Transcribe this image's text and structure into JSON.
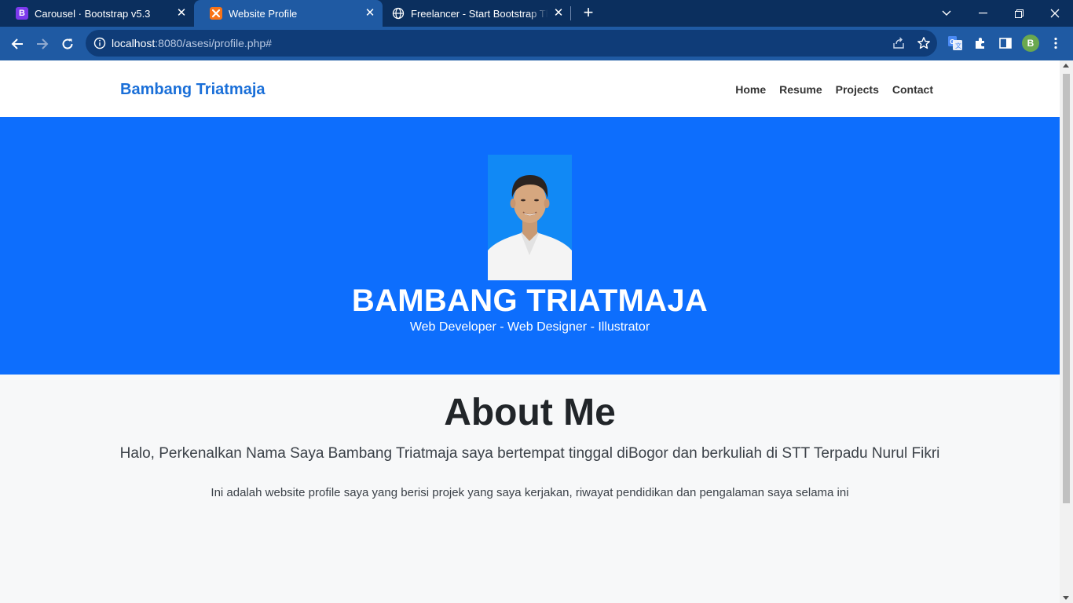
{
  "browser": {
    "tabs": [
      {
        "title": "Carousel · Bootstrap v5.3",
        "favicon": "B",
        "favicon_color": "#7c3aed"
      },
      {
        "title": "Website Profile",
        "favicon": "xampp",
        "favicon_color": "#f97316"
      },
      {
        "title": "Freelancer - Start Bootstrap Theme",
        "favicon": "globe",
        "favicon_color": "#ffffff"
      }
    ],
    "active_tab": 1,
    "url_host": "localhost",
    "url_rest": ":8080/asesi/profile.php#",
    "profile_initial": "B",
    "colors": {
      "tabbar": "#0b2f5e",
      "toolbar": "#1f5aa3",
      "omnibox": "#0f3c78"
    }
  },
  "site": {
    "brand": "Bambang Triatmaja",
    "nav": [
      "Home",
      "Resume",
      "Projects",
      "Contact"
    ],
    "hero": {
      "name": "BAMBANG TRIATMAJA",
      "subtitle": "Web Developer - Web Designer - Illustrator",
      "color": "#0d6efd"
    },
    "about": {
      "title": "About Me",
      "lead": "Halo, Perkenalkan Nama Saya Bambang Triatmaja saya bertempat tinggal diBogor dan berkuliah di STT Terpadu Nurul Fikri",
      "text": "Ini adalah website profile saya yang berisi projek yang saya kerjakan, riwayat pendidikan dan pengalaman saya selama ini"
    }
  }
}
